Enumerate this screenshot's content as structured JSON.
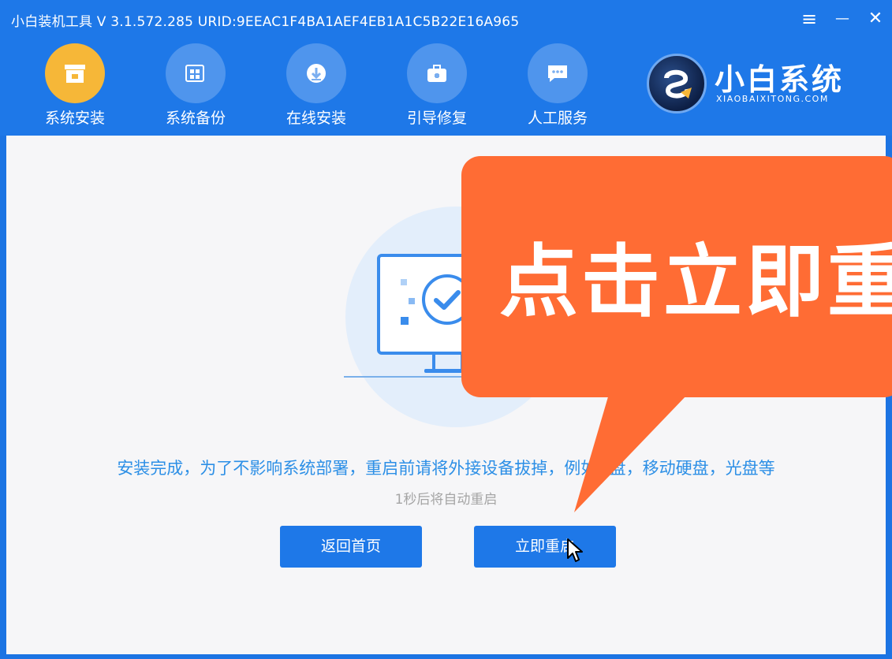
{
  "window": {
    "title": "小白装机工具 V 3.1.572.285 URID:9EEAC1F4BA1AEF4EB1A1C5B22E16A965",
    "controls": {
      "menu": "≡",
      "minimize": "—",
      "close": "✕"
    }
  },
  "nav": {
    "items": [
      {
        "label": "系统安装",
        "icon": "box-icon",
        "active": true
      },
      {
        "label": "系统备份",
        "icon": "windows-icon",
        "active": false
      },
      {
        "label": "在线安装",
        "icon": "download-icon",
        "active": false
      },
      {
        "label": "引导修复",
        "icon": "toolbox-icon",
        "active": false
      },
      {
        "label": "人工服务",
        "icon": "chat-icon",
        "active": false
      }
    ]
  },
  "logo": {
    "name": "小白系统",
    "subtitle": "XIAOBAIXITONG.COM"
  },
  "main": {
    "message": "安装完成，为了不影响系统部署，重启前请将外接设备拔掉，例如U盘，移动硬盘，光盘等",
    "countdown": "1秒后将自动重启",
    "back_button": "返回首页",
    "restart_button": "立即重启"
  },
  "callout": {
    "text": "点击立即重启"
  },
  "colors": {
    "header": "#1e78e8",
    "active_nav": "#f6b738",
    "callout": "#ff6c34",
    "message_text": "#2c8fe6",
    "button": "#1e78e8"
  }
}
